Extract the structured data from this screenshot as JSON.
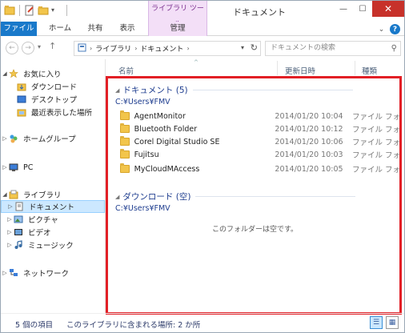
{
  "window": {
    "title": "ドキュメント",
    "context_tab_group": "ライブラリ ツール",
    "controls": {
      "minimize": "—",
      "maximize": "☐",
      "close": "✕"
    }
  },
  "ribbon": {
    "tabs": [
      {
        "label": "ファイル"
      },
      {
        "label": "ホーム"
      },
      {
        "label": "共有"
      },
      {
        "label": "表示"
      },
      {
        "label": "管理"
      }
    ],
    "help": "?"
  },
  "navigation": {
    "breadcrumbs": [
      "ライブラリ",
      "ドキュメント"
    ],
    "search_placeholder": "ドキュメントの検索"
  },
  "sidebar": {
    "items": [
      {
        "label": "お気に入り",
        "level": 0,
        "icon": "star-icon"
      },
      {
        "label": "ダウンロード",
        "level": 1,
        "icon": "download-folder-icon"
      },
      {
        "label": "デスクトップ",
        "level": 1,
        "icon": "desktop-icon"
      },
      {
        "label": "最近表示した場所",
        "level": 1,
        "icon": "recent-places-icon"
      },
      {
        "label": "ホームグループ",
        "level": 0,
        "icon": "homegroup-icon"
      },
      {
        "label": "PC",
        "level": 0,
        "icon": "pc-icon"
      },
      {
        "label": "ライブラリ",
        "level": 0,
        "icon": "library-icon"
      },
      {
        "label": "ドキュメント",
        "level": 1,
        "icon": "documents-icon",
        "selected": true
      },
      {
        "label": "ピクチャ",
        "level": 1,
        "icon": "pictures-icon"
      },
      {
        "label": "ビデオ",
        "level": 1,
        "icon": "videos-icon"
      },
      {
        "label": "ミュージック",
        "level": 1,
        "icon": "music-icon"
      },
      {
        "label": "ネットワーク",
        "level": 0,
        "icon": "network-icon"
      }
    ]
  },
  "columns": {
    "name": "名前",
    "date": "更新日時",
    "type": "種類"
  },
  "groups": [
    {
      "title": "ドキュメント (5)",
      "path": "C:¥Users¥FMV",
      "files": [
        {
          "name": "AgentMonitor",
          "date": "2014/01/20 10:04",
          "type": "ファイル フォ"
        },
        {
          "name": "Bluetooth Folder",
          "date": "2014/01/20 10:12",
          "type": "ファイル フォ"
        },
        {
          "name": "Corel Digital Studio SE",
          "date": "2014/01/20 10:06",
          "type": "ファイル フォ"
        },
        {
          "name": "Fujitsu",
          "date": "2014/01/20 10:03",
          "type": "ファイル フォ"
        },
        {
          "name": "MyCloudMAccess",
          "date": "2014/01/20 10:05",
          "type": "ファイル フォ"
        }
      ]
    },
    {
      "title": "ダウンロード (空)",
      "path": "C:¥Users¥FMV",
      "empty_message": "このフォルダーは空です。"
    }
  ],
  "status": {
    "item_count": "5 個の項目",
    "locations": "このライブラリに含まれる場所: 2 か所"
  },
  "colors": {
    "accent": "#1979ca",
    "highlight_border": "#e21f26",
    "group_heading": "#1e3d8f",
    "context_tab": "#f3dff7",
    "selected_bg": "#cce8ff"
  }
}
